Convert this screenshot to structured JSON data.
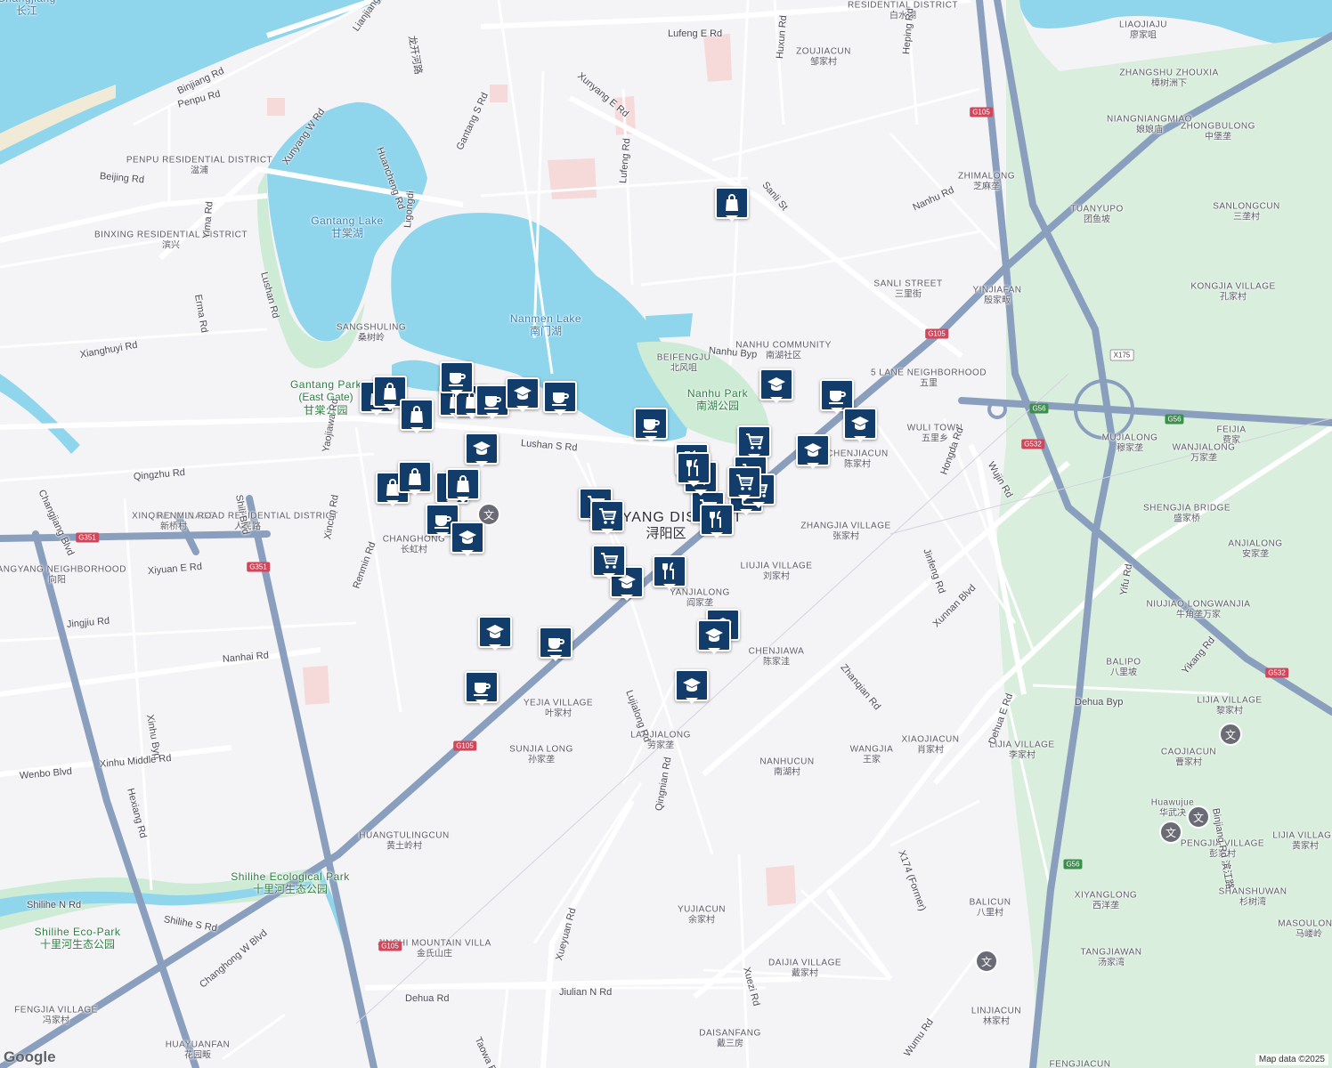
{
  "attribution": "Map data ©2025",
  "logo": "Google",
  "colors": {
    "water": "#8fd5ec",
    "park": "#cdebd5",
    "highway": "#8a9fbd",
    "major": "#ffffff",
    "background": "#f4f3f6",
    "pin": "#123c6a"
  },
  "district": {
    "en": "XUNYANG DISTRICT",
    "zh": "浔阳区"
  },
  "water_labels": [
    {
      "en": "Gantang Lake",
      "zh": "甘棠湖"
    },
    {
      "en": "Nanmen Lake",
      "zh": "南门湖"
    },
    {
      "en": "Changjiang",
      "zh": "长江"
    }
  ],
  "park_labels": [
    {
      "en": "Gantang Park",
      "zh": "(East Gate)"
    },
    {
      "en": "甘棠公园",
      "zh": ""
    },
    {
      "en": "Nanhu Park",
      "zh": "南湖公园"
    },
    {
      "en": "Shilihe Ecological Park",
      "zh": "十里河生态公园"
    },
    {
      "en": "Shilihe Eco-Park",
      "zh": "十里河生态公园"
    }
  ],
  "places": [
    {
      "en": "RESIDENTIAL DISTRICT",
      "zh": "白水湖"
    },
    {
      "en": "ZOUJIACUN",
      "zh": "邹家村"
    },
    {
      "en": "LIAOJIAJU",
      "zh": "廖家咀"
    },
    {
      "en": "ZHANGSHU ZHOUXIA",
      "zh": "樟树洲下"
    },
    {
      "en": "NIANGNIANGMIAO",
      "zh": "娘娘庙"
    },
    {
      "en": "ZHONGBULONG",
      "zh": "中堡垄"
    },
    {
      "en": "PENPU RESIDENTIAL DISTRICT",
      "zh": "湓浦"
    },
    {
      "en": "ZHIMALONG",
      "zh": "芝麻垄"
    },
    {
      "en": "TUANYUPO",
      "zh": "团鱼坡"
    },
    {
      "en": "SANLONGCUN",
      "zh": "三垄村"
    },
    {
      "en": "BINXING RESIDENTIAL DISTRICT",
      "zh": "滨兴"
    },
    {
      "en": "SANLI STREET",
      "zh": "三里街"
    },
    {
      "en": "YINJIAFAN",
      "zh": "殷家畈"
    },
    {
      "en": "KONGJIA VILLAGE",
      "zh": "孔家村"
    },
    {
      "en": "SANGSHULING",
      "zh": "桑树岭"
    },
    {
      "en": "NANHU COMMUNITY",
      "zh": "南湖社区"
    },
    {
      "en": "BEIFENGJU",
      "zh": "北风咀"
    },
    {
      "en": "5 LANE NEIGHBORHOOD",
      "zh": "五里"
    },
    {
      "en": "FEIJIA",
      "zh": "费家"
    },
    {
      "en": "WULI TOWN",
      "zh": "五里乡"
    },
    {
      "en": "MUJIALONG",
      "zh": "穆家垄"
    },
    {
      "en": "WANJIALONG",
      "zh": "万家垄"
    },
    {
      "en": "CHENJIACUN",
      "zh": "陈家村"
    },
    {
      "en": "XINQIAO VILLAGE",
      "zh": "新桥村"
    },
    {
      "en": "RENMIN ROAD RESIDENTIAL DISTRICT",
      "zh": "人民路"
    },
    {
      "en": "SHENGJIA BRIDGE",
      "zh": "盛家桥"
    },
    {
      "en": "ZHANGJIA VILLAGE",
      "zh": "张家村"
    },
    {
      "en": "CHANGHONG",
      "zh": "长虹村"
    },
    {
      "en": "ANJIALONG",
      "zh": "安家垄"
    },
    {
      "en": "XIANGYANG NEIGHBORHOOD",
      "zh": "向阳"
    },
    {
      "en": "LIUJIA VILLAGE",
      "zh": "刘家村"
    },
    {
      "en": "NIUJIAO LONGWANJIA",
      "zh": "牛角垄万家"
    },
    {
      "en": "YANJIALONG",
      "zh": "阎家垄"
    },
    {
      "en": "CHENJIAWA",
      "zh": "陈家洼"
    },
    {
      "en": "BALIPO",
      "zh": "八里坡"
    },
    {
      "en": "LIJIA VILLAGE",
      "zh": "黎家村"
    },
    {
      "en": "YEJIA VILLAGE",
      "zh": "叶家村"
    },
    {
      "en": "XIAOJIACUN",
      "zh": "肖家村"
    },
    {
      "en": "LIJIA VILLAGE",
      "zh": "李家村"
    },
    {
      "en": "LAOJIALONG",
      "zh": "劳家垄"
    },
    {
      "en": "CAOJIACUN",
      "zh": "曹家村"
    },
    {
      "en": "SUNJIA LONG",
      "zh": "孙家垄"
    },
    {
      "en": "WANGJIA",
      "zh": "王家"
    },
    {
      "en": "NANHUCUN",
      "zh": "南湖村"
    },
    {
      "en": "Huawujue",
      "zh": "华武决"
    },
    {
      "en": "LIJIA VILLAGE",
      "zh": "黄家村"
    },
    {
      "en": "HUANGTULINGCUN",
      "zh": "黄土岭村"
    },
    {
      "en": "PENGJIA VILLAGE",
      "zh": "彭家村"
    },
    {
      "en": "BALICUN",
      "zh": "八里村"
    },
    {
      "en": "XIYANGLONG",
      "zh": "西洋垄"
    },
    {
      "en": "SHANSHUWAN",
      "zh": "杉树湾"
    },
    {
      "en": "YUJIACUN",
      "zh": "余家村"
    },
    {
      "en": "JINSHI MOUNTAIN VILLA",
      "zh": "金氏山庄"
    },
    {
      "en": "MASOULONG",
      "zh": "马嵝岭"
    },
    {
      "en": "DAIJIA VILLAGE",
      "zh": "戴家村"
    },
    {
      "en": "TANGJIAWAN",
      "zh": "汤家湾"
    },
    {
      "en": "LINJIACUN",
      "zh": "林家村"
    },
    {
      "en": "DAISANFANG",
      "zh": "戴三房"
    },
    {
      "en": "FENGJIA VILLAGE",
      "zh": "冯家村"
    },
    {
      "en": "HUAYUANFAN",
      "zh": "花园畈"
    },
    {
      "en": "FENGJIACUN",
      "zh": ""
    }
  ],
  "roads": [
    "Lufeng E Rd",
    "Binjiang Rd",
    "Penpu Rd",
    "Xunyang W Rd",
    "Huancheng Rd",
    "Gantang S Rd",
    "Xunyang E Rd",
    "Lufeng Rd",
    "Huxun Rd",
    "Heping Rd",
    "Nanhu Rd",
    "Sanli St",
    "Beijing Rd",
    "Ligongdi",
    "Yima Rd",
    "Lushan Rd",
    "Nanhu Byp",
    "Erma Rd",
    "Xianghuyi Rd",
    "Lushan S Rd",
    "Qingzhu Rd",
    "Yaojiawa Rd",
    "Shili Blvd",
    "Changjiang Blvd",
    "Xincun Rd",
    "Renmin Rd",
    "Xiyuan E Rd",
    "Jingjiu Rd",
    "Nanhai Rd",
    "Xinhu Byp",
    "Wenbo Blvd",
    "Xinhu Middle Rd",
    "Hexiang Rd",
    "Jinfeng Rd",
    "Xunnan Blvd",
    "Hongda Rd",
    "Wujin Rd",
    "Zhanqian Rd",
    "Dehua Byp",
    "Dehua E Rd",
    "Lujialong Rd",
    "Yikang Rd",
    "Yifu Rd",
    "Xueyuan Rd",
    "Qingnian Rd",
    "Changhong W Blvd",
    "Shilihe N Rd",
    "Shilihe S Rd",
    "Dehua Rd",
    "Jiulian N Rd",
    "Taowa E Rd",
    "Xuezi Rd",
    "Wumu Rd",
    "X174 (Former)",
    "Binjiang Rd 滨江路",
    "Lianjiang N Rd",
    "龙开河路"
  ],
  "shields": [
    "G105",
    "G105",
    "G105",
    "G105",
    "G56",
    "G56",
    "G56",
    "G532",
    "G532",
    "G351",
    "G351",
    "X175"
  ],
  "pin_types": [
    "shopping-bag",
    "cafe",
    "school",
    "cart",
    "restaurant"
  ]
}
